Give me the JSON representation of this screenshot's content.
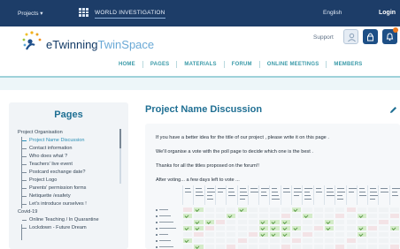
{
  "topbar": {
    "projects_label": "Projects ▾",
    "breadcrumb": "WORLD INVESTIGATION",
    "language": "English",
    "login": "Login"
  },
  "header": {
    "logo_text_a": "eTwinning",
    "logo_text_b": "TwinSpace",
    "support": "Support"
  },
  "nav": [
    "HOME",
    "PAGES",
    "MATERIALS",
    "FORUM",
    "ONLINE MEETINGS",
    "MEMBERS"
  ],
  "sidebar": {
    "title": "Pages",
    "tree": [
      {
        "label": "Project Organisation",
        "level": 0,
        "active": false
      },
      {
        "label": "Project Name Discussion",
        "level": 1,
        "active": true
      },
      {
        "label": "Contact information",
        "level": 1,
        "active": false
      },
      {
        "label": "Who does what ?",
        "level": 1,
        "active": false
      },
      {
        "label": "Teachers' live event",
        "level": 1,
        "active": false
      },
      {
        "label": "Postcard exchange date?",
        "level": 1,
        "active": false
      },
      {
        "label": "Project Logo",
        "level": 1,
        "active": false
      },
      {
        "label": "Parents' permission forms",
        "level": 1,
        "active": false
      },
      {
        "label": "Netiquette /esafety",
        "level": 1,
        "active": false
      },
      {
        "label": "Let's introduce ourselves !",
        "level": 1,
        "active": false
      },
      {
        "label": "Covid-19",
        "level": 0,
        "active": false
      },
      {
        "label": "Online Teaching / In Quarantine",
        "level": 1,
        "active": false
      },
      {
        "label": "Lockdown - Future Dream",
        "level": 1,
        "active": false
      }
    ]
  },
  "content": {
    "title": "Project Name Discussion",
    "paragraphs": [
      "If you have a better idea for the title of our project , please write it on this page .",
      "We'll organise a vote with the poll page to decide which one is the best .",
      "Thanks for all the titles proposed on the forum!!",
      "After voting... a few days left to vote ..."
    ]
  },
  "colors": {
    "topbar": "#1d3d68",
    "accent": "#1f6f93",
    "nav": "#3a9aa8",
    "notification": "#ee7a20"
  },
  "icons": [
    "grid-icon",
    "user-icon",
    "lock-icon",
    "bell-icon",
    "edit-icon",
    "logo-stars-icon"
  ]
}
